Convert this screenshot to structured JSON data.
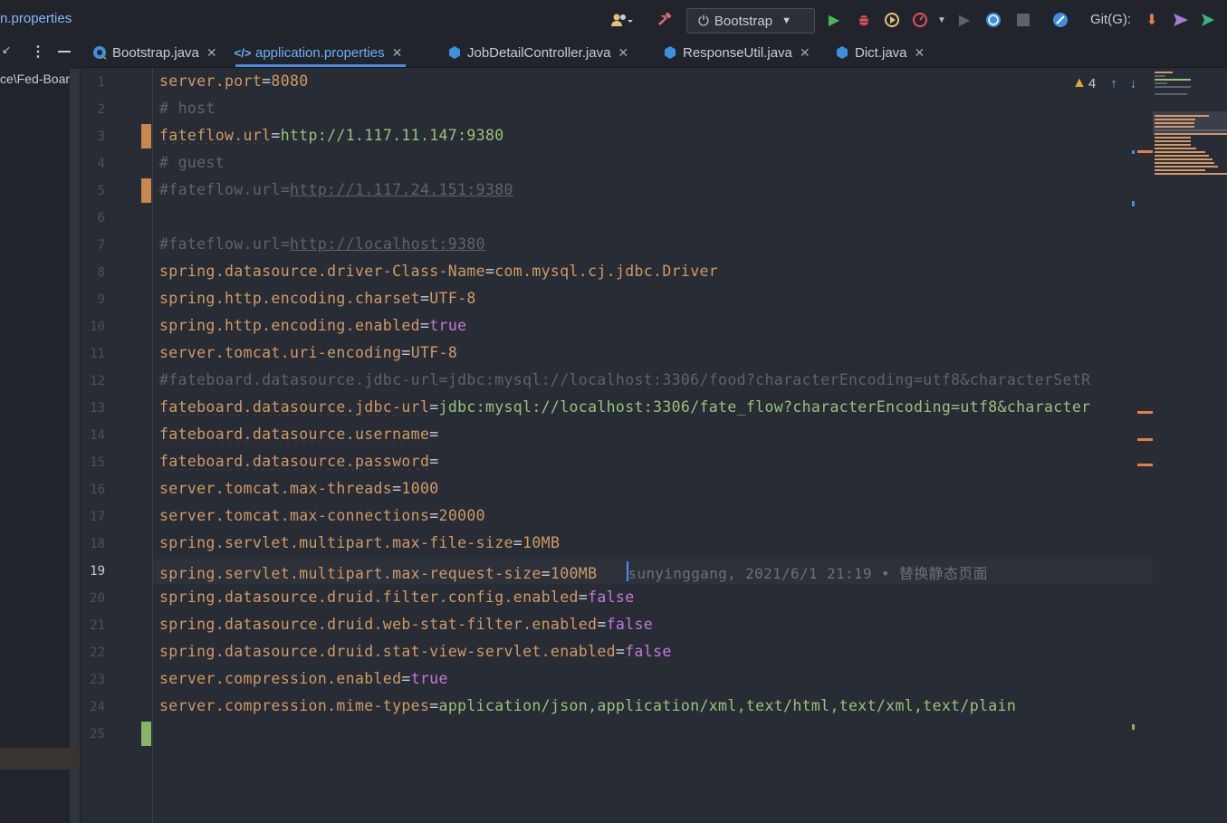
{
  "window": {
    "breadcrumb": "n.properties",
    "run_config": "Bootstrap",
    "git_label": "Git(G):"
  },
  "left_panel": {
    "path_text": "ce\\Fed-Boar"
  },
  "tabs": [
    {
      "label": "Bootstrap.java",
      "icon": "java-class-icon",
      "active": false
    },
    {
      "label": "application.properties",
      "icon": "properties-file-icon",
      "active": true
    },
    {
      "label": "JobDetailController.java",
      "icon": "java-class-icon",
      "active": false
    },
    {
      "label": "ResponseUtil.java",
      "icon": "java-class-icon",
      "active": false
    },
    {
      "label": "Dict.java",
      "icon": "java-class-icon",
      "active": false
    }
  ],
  "inspections": {
    "warning_count": "4"
  },
  "editor": {
    "current_line": 19,
    "blame": "sunyinggang, 2021/6/1 21:19 • 替换静态页面",
    "lines": [
      {
        "n": "1",
        "key": "server.port",
        "eq": "=",
        "val": "8080",
        "type": "num"
      },
      {
        "n": "2",
        "text": "# host",
        "type": "comment"
      },
      {
        "n": "3",
        "key": "fateflow.url",
        "eq": "=",
        "val": "http://1.117.11.147:9380",
        "type": "str",
        "warn": true
      },
      {
        "n": "4",
        "text": "# guest",
        "type": "comment"
      },
      {
        "n": "5",
        "prefix": "#fateflow.url=",
        "link": "http://1.117.24.151:9380",
        "type": "commentlink"
      },
      {
        "n": "6",
        "type": "empty"
      },
      {
        "n": "7",
        "prefix": "#fateflow.url=",
        "link": "http://localhost:9380",
        "type": "commentlink"
      },
      {
        "n": "8",
        "key": "spring.datasource.driver-Class-Name",
        "eq": "=",
        "val": "com.mysql.cj.jdbc.Driver",
        "type": "plain"
      },
      {
        "n": "9",
        "key": "spring.http.encoding.charset",
        "eq": "=",
        "val": "UTF-8",
        "type": "num"
      },
      {
        "n": "10",
        "key": "spring.http.encoding.enabled",
        "eq": "=",
        "val": "true",
        "type": "bool"
      },
      {
        "n": "11",
        "key": "server.tomcat.uri-encoding",
        "eq": "=",
        "val": "UTF-8",
        "type": "num"
      },
      {
        "n": "12",
        "text": "#fateboard.datasource.jdbc-url=jdbc:mysql://localhost:3306/food?characterEncoding=utf8&characterSetR",
        "type": "comment"
      },
      {
        "n": "13",
        "key": "fateboard.datasource.jdbc-url",
        "eq": "=",
        "val": "jdbc:mysql://localhost:3306/fate_flow?characterEncoding=utf8&character",
        "type": "str",
        "warn": true
      },
      {
        "n": "14",
        "key": "fateboard.datasource.username",
        "eq": "=",
        "val": "",
        "type": "str",
        "warn": true
      },
      {
        "n": "15",
        "key": "fateboard.datasource.password",
        "eq": "=",
        "val": "",
        "type": "str",
        "warn": true
      },
      {
        "n": "16",
        "key": "server.tomcat.max-threads",
        "eq": "=",
        "val": "1000",
        "type": "num"
      },
      {
        "n": "17",
        "key": "server.tomcat.max-connections",
        "eq": "=",
        "val": "20000",
        "type": "num"
      },
      {
        "n": "18",
        "key": "spring.servlet.multipart.max-file-size",
        "eq": "=",
        "val": "10MB",
        "type": "num"
      },
      {
        "n": "19",
        "key": "spring.servlet.multipart.max-request-size",
        "eq": "=",
        "val": "100MB",
        "type": "num"
      },
      {
        "n": "20",
        "key": "spring.datasource.druid.filter.config.enabled",
        "eq": "=",
        "val": "false",
        "type": "bool"
      },
      {
        "n": "21",
        "key": "spring.datasource.druid.web-stat-filter.enabled",
        "eq": "=",
        "val": "false",
        "type": "bool"
      },
      {
        "n": "22",
        "key": "spring.datasource.druid.stat-view-servlet.enabled",
        "eq": "=",
        "val": "false",
        "type": "bool"
      },
      {
        "n": "23",
        "key": "server.compression.enabled",
        "eq": "=",
        "val": "true",
        "type": "bool"
      },
      {
        "n": "24",
        "key": "server.compression.mime-types",
        "eq": "=",
        "val": "application/json,application/xml,text/html,text/xml,text/plain",
        "type": "str"
      },
      {
        "n": "25",
        "type": "empty"
      }
    ]
  },
  "colors": {
    "background": "#282c34",
    "key": "#d19a66",
    "string": "#98c379",
    "boolean": "#c678dd",
    "comment": "#5c6370",
    "accent": "#4a88e2",
    "change_modified": "#c7874d",
    "change_added": "#86b563"
  }
}
